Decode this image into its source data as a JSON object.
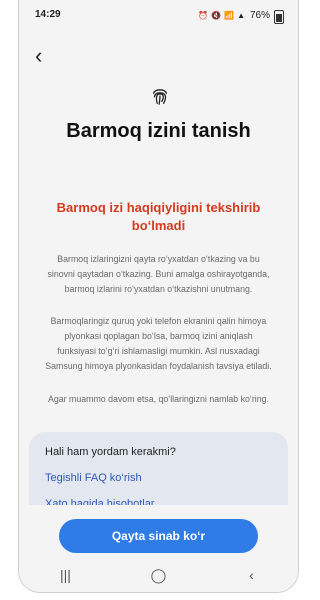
{
  "status": {
    "time": "14:29",
    "battery": "76%",
    "icons": [
      "alarm-icon",
      "mute-icon",
      "wifi-icon",
      "signal-icon",
      "battery-icon"
    ]
  },
  "header": {
    "back_icon": "chevron-left-icon",
    "fingerprint_icon": "fingerprint-icon",
    "title": "Barmoq izini tanish"
  },
  "error": {
    "message": "Barmoq izi haqiqiyligini tekshirib bo‘lmadi"
  },
  "paragraphs": [
    "Barmoq izlaringizni qayta ro‘yxatdan o‘tkazing va bu sinovni qaytadan o‘tkazing. Buni amalga oshirayotganda, barmoq izlarini ro‘yxatdan o‘tkazishni unutmang.",
    "Barmoqlaringiz quruq yoki telefon ekranini qalin himoya plyonkasi qoplagan bo‘lsa, barmoq izini aniqlash funksiyasi to‘g‘ri ishlamasligi mumkin. Asl nusxadagi Samsung himoya plyonkasidan foydalanish tavsiya etiladi.",
    "Agar muammo davom etsa, qo‘llaringizni namlab ko‘ring."
  ],
  "help": {
    "title": "Hali ham yordam kerakmi?",
    "links": [
      "Tegishli FAQ ko‘rish",
      "Xato haqida hisobotlar"
    ]
  },
  "actions": {
    "retry_label": "Qayta sinab ko‘r"
  },
  "navbar": {
    "recent": "|||",
    "home": "◯",
    "back": "‹"
  },
  "colors": {
    "error": "#d63a1d",
    "accent": "#2f7ce6",
    "link": "#2f58b6"
  }
}
